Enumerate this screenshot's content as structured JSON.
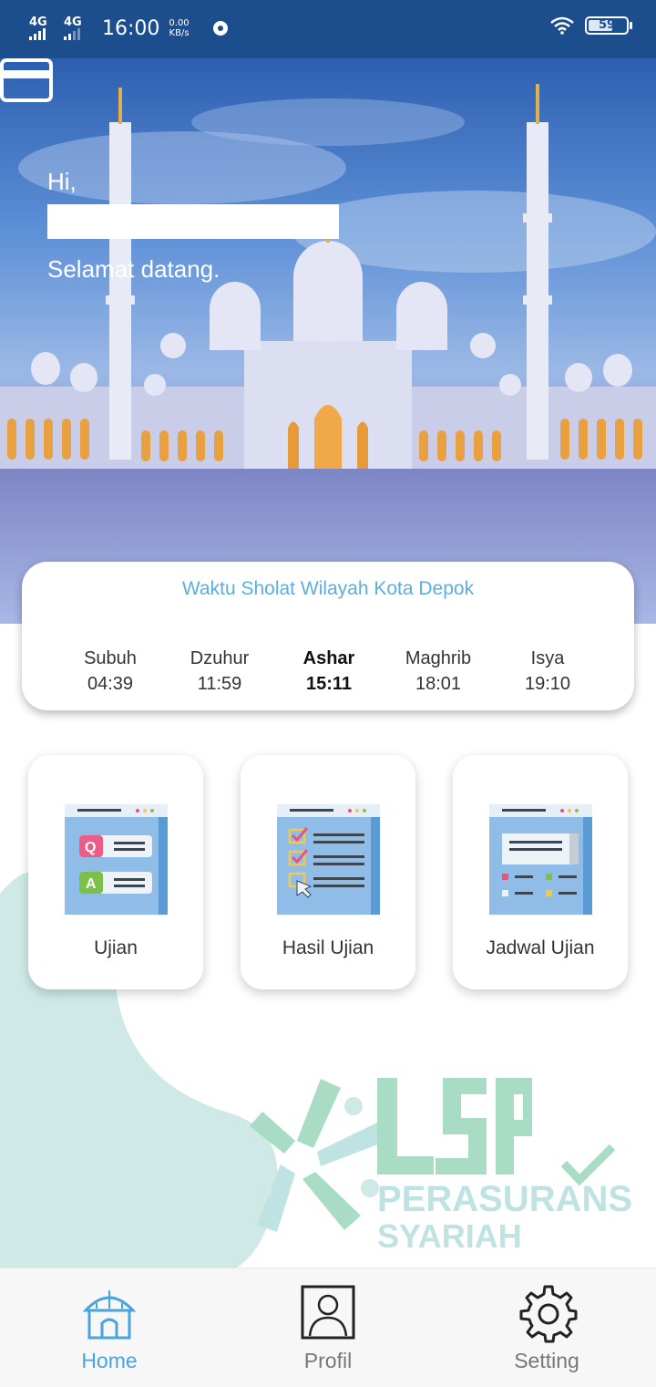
{
  "status_bar": {
    "network1": "4G",
    "network2": "4G",
    "time": "16:00",
    "speed_value": "0.00",
    "speed_unit": "KB/s",
    "battery": "59"
  },
  "hero": {
    "greeting": "Hi,",
    "welcome": "Selamat datang."
  },
  "prayer": {
    "title": "Waktu Sholat Wilayah Kota Depok",
    "times": [
      {
        "name": "Subuh",
        "time": "04:39"
      },
      {
        "name": "Dzuhur",
        "time": "11:59"
      },
      {
        "name": "Ashar",
        "time": "15:11"
      },
      {
        "name": "Maghrib",
        "time": "18:01"
      },
      {
        "name": "Isya",
        "time": "19:10"
      }
    ],
    "active_index": 2
  },
  "menu": {
    "items": [
      {
        "label": "Ujian",
        "icon": "qa-document-icon"
      },
      {
        "label": "Hasil Ujian",
        "icon": "checklist-document-icon"
      },
      {
        "label": "Jadwal Ujian",
        "icon": "schedule-document-icon"
      }
    ]
  },
  "logo": {
    "line1": "PERASURANSIAN",
    "line2": "SYARIAH"
  },
  "bottom_nav": {
    "items": [
      {
        "label": "Home",
        "icon": "home-icon"
      },
      {
        "label": "Profil",
        "icon": "profile-icon"
      },
      {
        "label": "Setting",
        "icon": "gear-icon"
      }
    ],
    "active_color": "#4aa3df"
  },
  "colors": {
    "status_bar": "#1c4e8e",
    "accent": "#5aaee0",
    "teal_blob": "#cfe9e6",
    "logo_green": "#a9dcc4"
  }
}
